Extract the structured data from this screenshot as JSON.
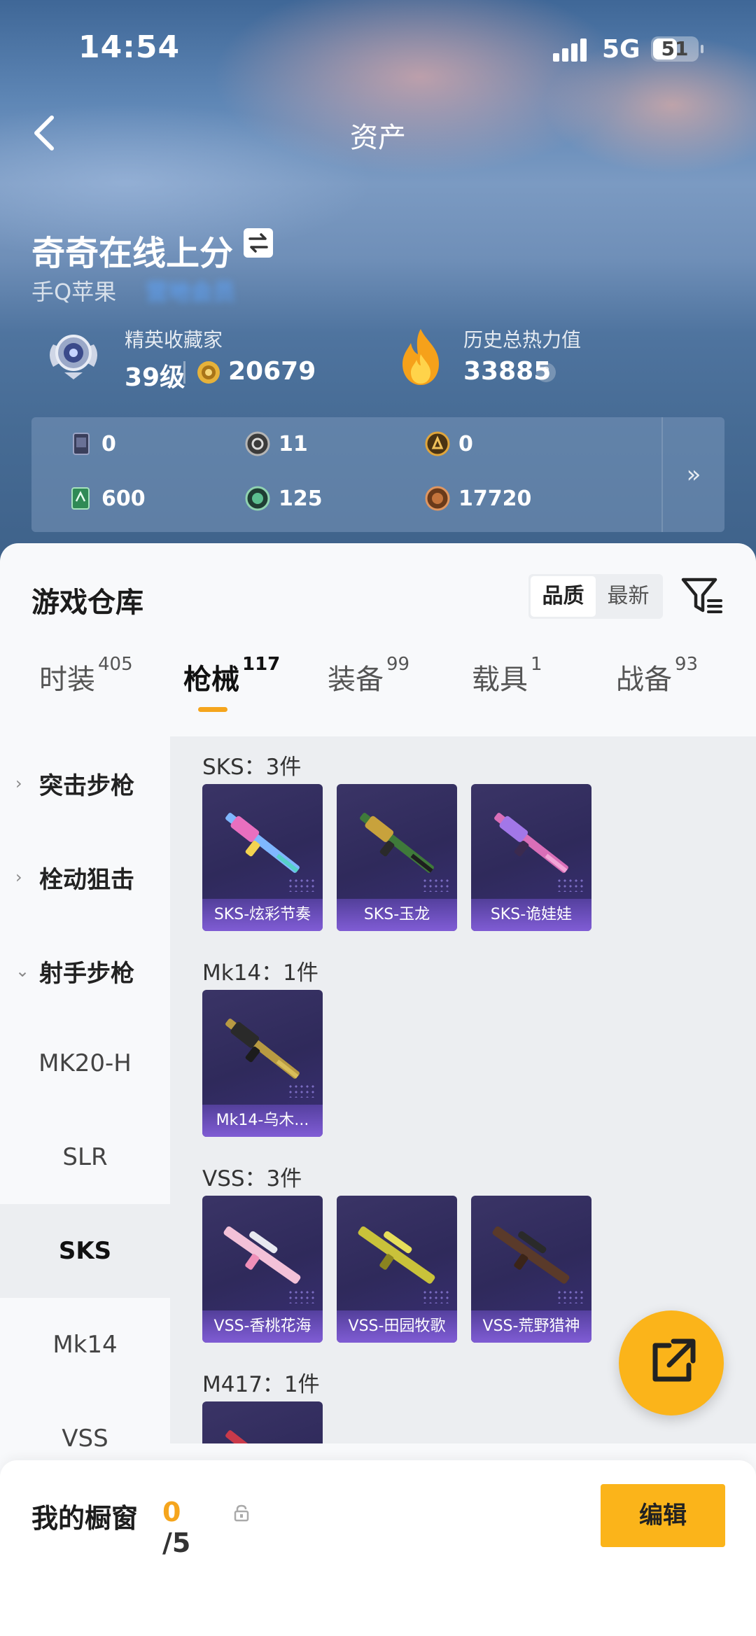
{
  "status_bar": {
    "time": "14:54",
    "network": "5G",
    "battery": "51"
  },
  "header": {
    "title": "资产"
  },
  "profile": {
    "username": "奇奇在线上分",
    "platform": "手Q苹果",
    "platform_link": "营地会员",
    "collector_title": "精英收藏家",
    "level": "39级",
    "collection_points": "20679",
    "heat_title": "历史总热力值",
    "heat_value": "33885",
    "help_symbol": "?"
  },
  "currencies": [
    {
      "icon": "card-icon",
      "value": "0"
    },
    {
      "icon": "silver-token-icon",
      "value": "11"
    },
    {
      "icon": "gold-token-icon",
      "value": "0"
    },
    {
      "icon": "green-card-icon",
      "value": "600"
    },
    {
      "icon": "green-coin-icon",
      "value": "125"
    },
    {
      "icon": "bronze-coin-icon",
      "value": "17720"
    }
  ],
  "currency_more": "»",
  "warehouse": {
    "title": "游戏仓库",
    "sort_options": [
      "品质",
      "最新"
    ],
    "sort_active": "品质",
    "tabs": [
      {
        "label": "时装",
        "count": "405"
      },
      {
        "label": "枪械",
        "count": "117"
      },
      {
        "label": "装备",
        "count": "99"
      },
      {
        "label": "载具",
        "count": "1"
      },
      {
        "label": "战备",
        "count": "93"
      }
    ],
    "active_tab": "枪械",
    "sidebar": [
      {
        "label": "突击步枪",
        "type": "group",
        "chev": "›"
      },
      {
        "label": "栓动狙击",
        "type": "group",
        "chev": "›"
      },
      {
        "label": "射手步枪",
        "type": "group",
        "chev": "⌄"
      },
      {
        "label": "MK20-H",
        "type": "item"
      },
      {
        "label": "SLR",
        "type": "item"
      },
      {
        "label": "SKS",
        "type": "item",
        "active": true
      },
      {
        "label": "Mk14",
        "type": "item"
      },
      {
        "label": "VSS",
        "type": "item"
      }
    ],
    "groups": [
      {
        "label": "SKS：3件",
        "items": [
          "SKS-炫彩节奏",
          "SKS-玉龙",
          "SKS-诡娃娃"
        ]
      },
      {
        "label": "Mk14：1件",
        "items": [
          "Mk14-乌木..."
        ]
      },
      {
        "label": "VSS：3件",
        "items": [
          "VSS-香桃花海",
          "VSS-田园牧歌",
          "VSS-荒野猎神"
        ]
      },
      {
        "label": "M417：1件",
        "items": [
          ""
        ]
      }
    ],
    "colors": {
      "accent": "#fbb41a",
      "card_bg": "#2f2a5b",
      "card_label": "#8c64e6"
    }
  },
  "showcase": {
    "label": "我的橱窗",
    "current": "0",
    "total": "/5",
    "edit_label": "编辑"
  }
}
